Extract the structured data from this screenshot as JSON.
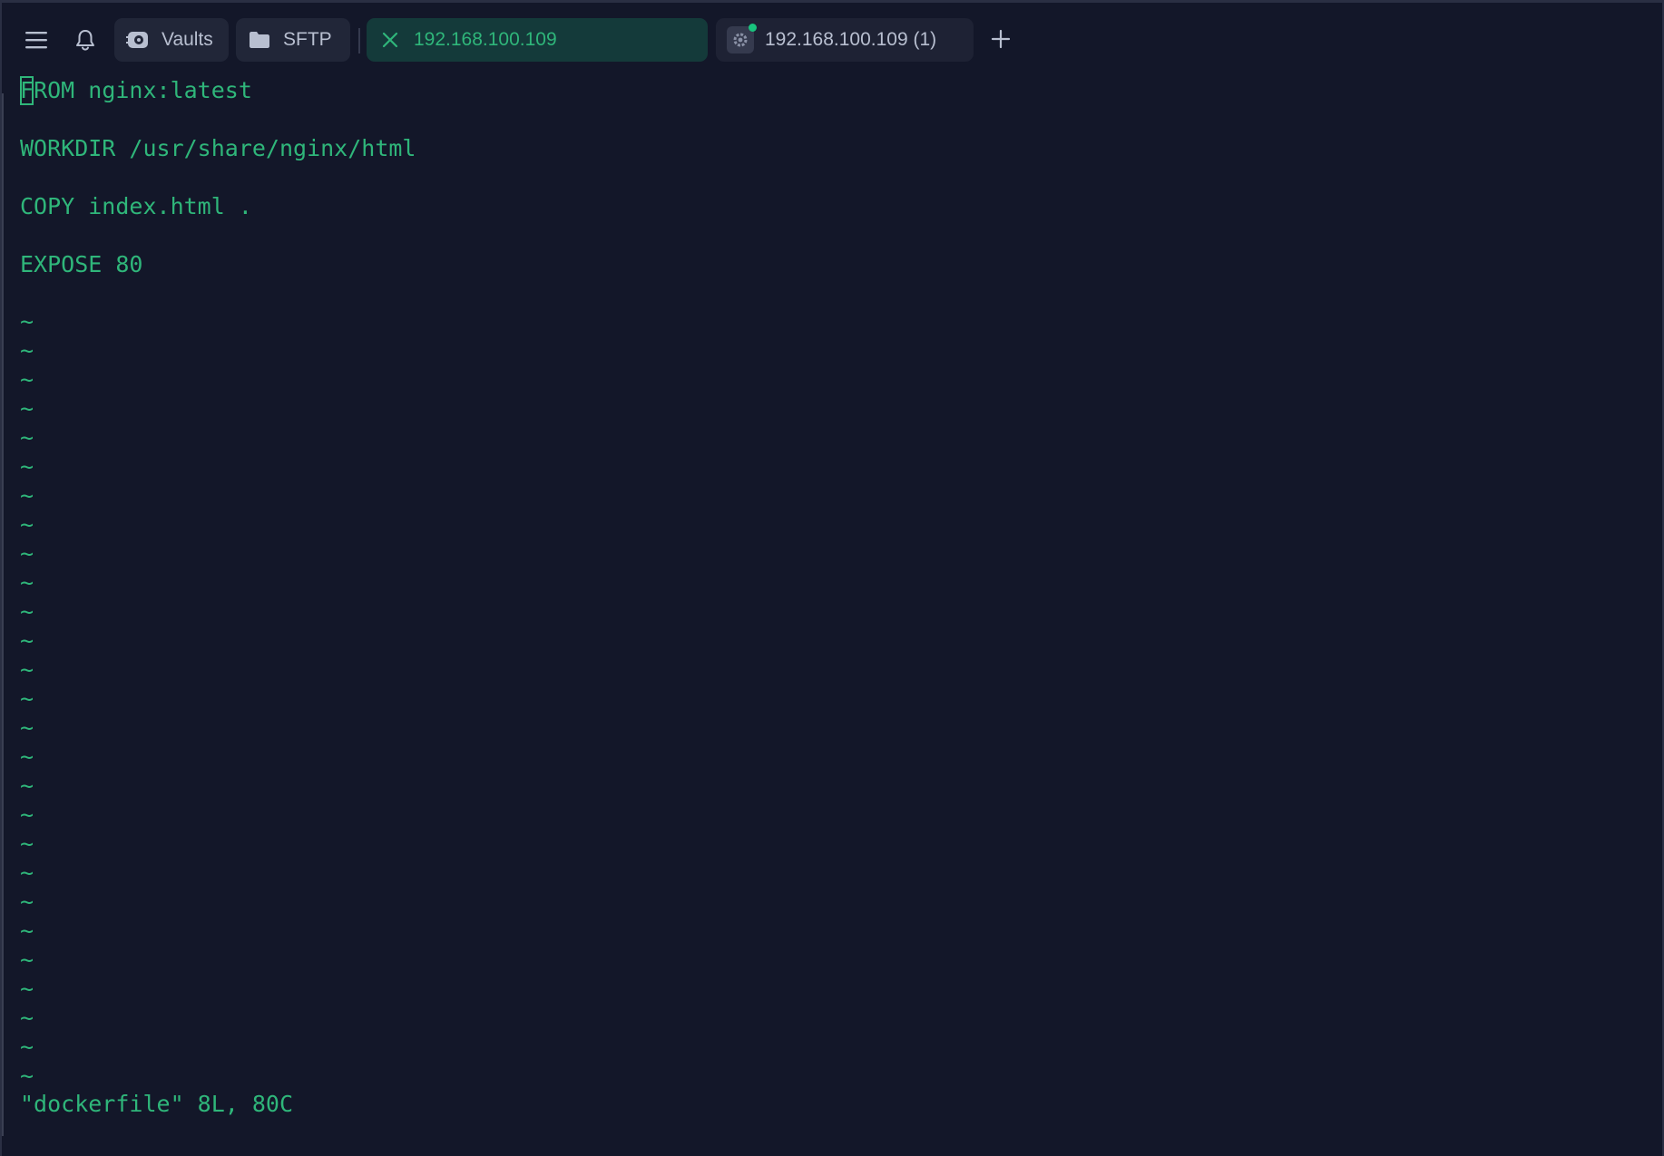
{
  "toolbar": {
    "menu_icon": "hamburger-menu-icon",
    "bell_icon": "bell-icon",
    "add_tab_icon": "plus-icon"
  },
  "tabs": [
    {
      "label": "Vaults",
      "icon": "vault-icon",
      "active": false
    },
    {
      "label": "SFTP",
      "icon": "folder-icon",
      "active": false
    },
    {
      "label": "192.168.100.109",
      "icon": "close-icon",
      "active": true
    },
    {
      "label": "192.168.100.109 (1)",
      "icon": "gear-icon",
      "active": false,
      "status_dot_color": "#19c37d"
    }
  ],
  "terminal": {
    "cursor_char": "F",
    "lines": [
      "ROM nginx:latest",
      "WORKDIR /usr/share/nginx/html",
      "COPY index.html .",
      "EXPOSE 80"
    ],
    "tilde": "~",
    "status_line": "\"dockerfile\" 8L, 80C"
  },
  "colors": {
    "background": "#131729",
    "text_green": "#2fb67a",
    "active_tab_bg": "#143a3a",
    "inactive_tab_bg": "#212638"
  }
}
